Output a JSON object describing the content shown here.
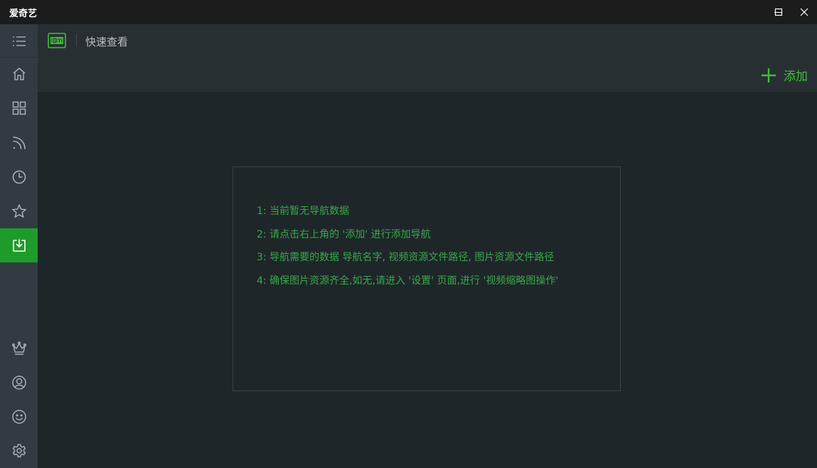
{
  "window": {
    "title": "爱奇艺",
    "controls": [
      "minimize-icon",
      "maximize-icon",
      "close-icon"
    ]
  },
  "sidebar": {
    "top_items": [
      {
        "icon": "menu-icon",
        "active": false
      },
      {
        "icon": "home-icon",
        "active": false
      },
      {
        "icon": "grid-icon",
        "active": false
      },
      {
        "icon": "rss-icon",
        "active": false
      },
      {
        "icon": "clock-icon",
        "active": false
      },
      {
        "icon": "star-icon",
        "active": false
      },
      {
        "icon": "download-icon",
        "active": true
      }
    ],
    "bottom_items": [
      {
        "icon": "crown-icon"
      },
      {
        "icon": "user-icon"
      },
      {
        "icon": "smile-icon"
      },
      {
        "icon": "gear-icon"
      }
    ]
  },
  "header": {
    "logo": "iqiyi-logo",
    "title": "快速查看",
    "add_label": "添加"
  },
  "info": {
    "lines": [
      "1: 当前暂无导航数据",
      "2: 请点击右上角的 '添加' 进行添加导航",
      "3: 导航需要的数据 导航名字, 视频资源文件路径, 图片资源文件路径",
      "4: 确保图片资源齐全,如无,请进入 '设置' 页面,进行 '视频缩略图操作'"
    ]
  },
  "colors": {
    "accent": "#1f9b2b",
    "accent_text": "#3fbe3a",
    "info_text": "#38a74a",
    "background": "#1f2629",
    "sidebar": "#313b41",
    "header": "#282f33",
    "titlebar": "#1b1b1b"
  }
}
